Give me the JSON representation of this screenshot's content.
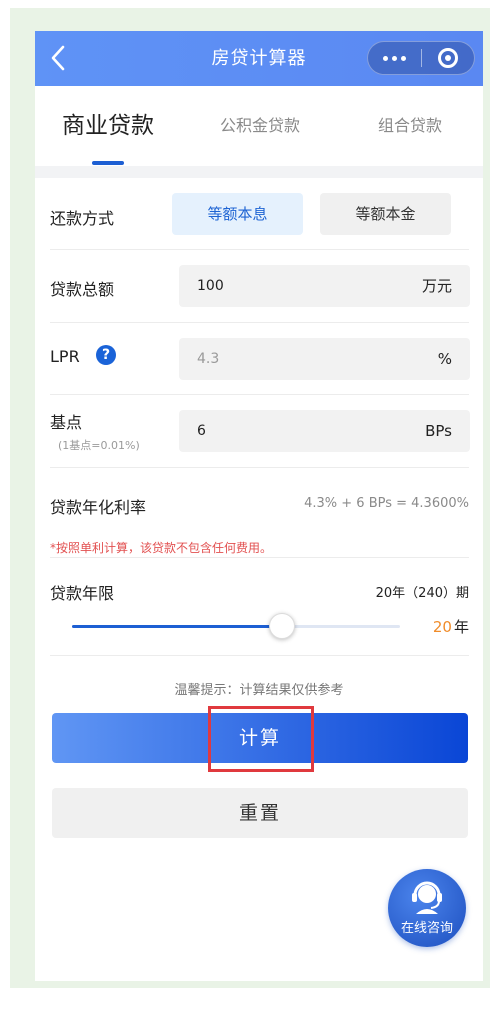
{
  "header": {
    "title": "房贷计算器",
    "back_icon": "chevron-left-icon",
    "more_icon": "more-dots-icon",
    "close_icon": "target-close-icon"
  },
  "tabs": [
    {
      "label": "商业贷款",
      "active": true
    },
    {
      "label": "公积金贷款",
      "active": false
    },
    {
      "label": "组合贷款",
      "active": false
    }
  ],
  "repayment": {
    "label": "还款方式",
    "options": [
      "等额本息",
      "等额本金"
    ],
    "selected": "等额本息"
  },
  "loan_amount": {
    "label": "贷款总额",
    "value": "100",
    "unit": "万元"
  },
  "lpr": {
    "label": "LPR",
    "help_glyph": "?",
    "placeholder": "4.3",
    "unit": "%"
  },
  "basis_point": {
    "label": "基点",
    "sublabel": "(1基点=0.01%)",
    "value": "6",
    "unit": "BPs"
  },
  "annual_rate": {
    "label": "贷款年化利率",
    "value": "4.3% + 6 BPs = 4.3600%"
  },
  "note": "*按照单利计算，该贷款不包含任何费用。",
  "term": {
    "label": "贷款年限",
    "summary": "20年（240）期",
    "years": "20",
    "years_unit": "年",
    "slider_fraction": 0.64
  },
  "hint": "温馨提示：计算结果仅供参考",
  "buttons": {
    "calculate": "计算",
    "reset": "重置"
  },
  "fab": {
    "label": "在线咨询",
    "icon": "headset-agent-icon"
  },
  "colors": {
    "primary": "#1d5fd3",
    "accent_orange": "#f08c2a",
    "note_red": "#e25050",
    "highlight_red": "#e0393e"
  }
}
